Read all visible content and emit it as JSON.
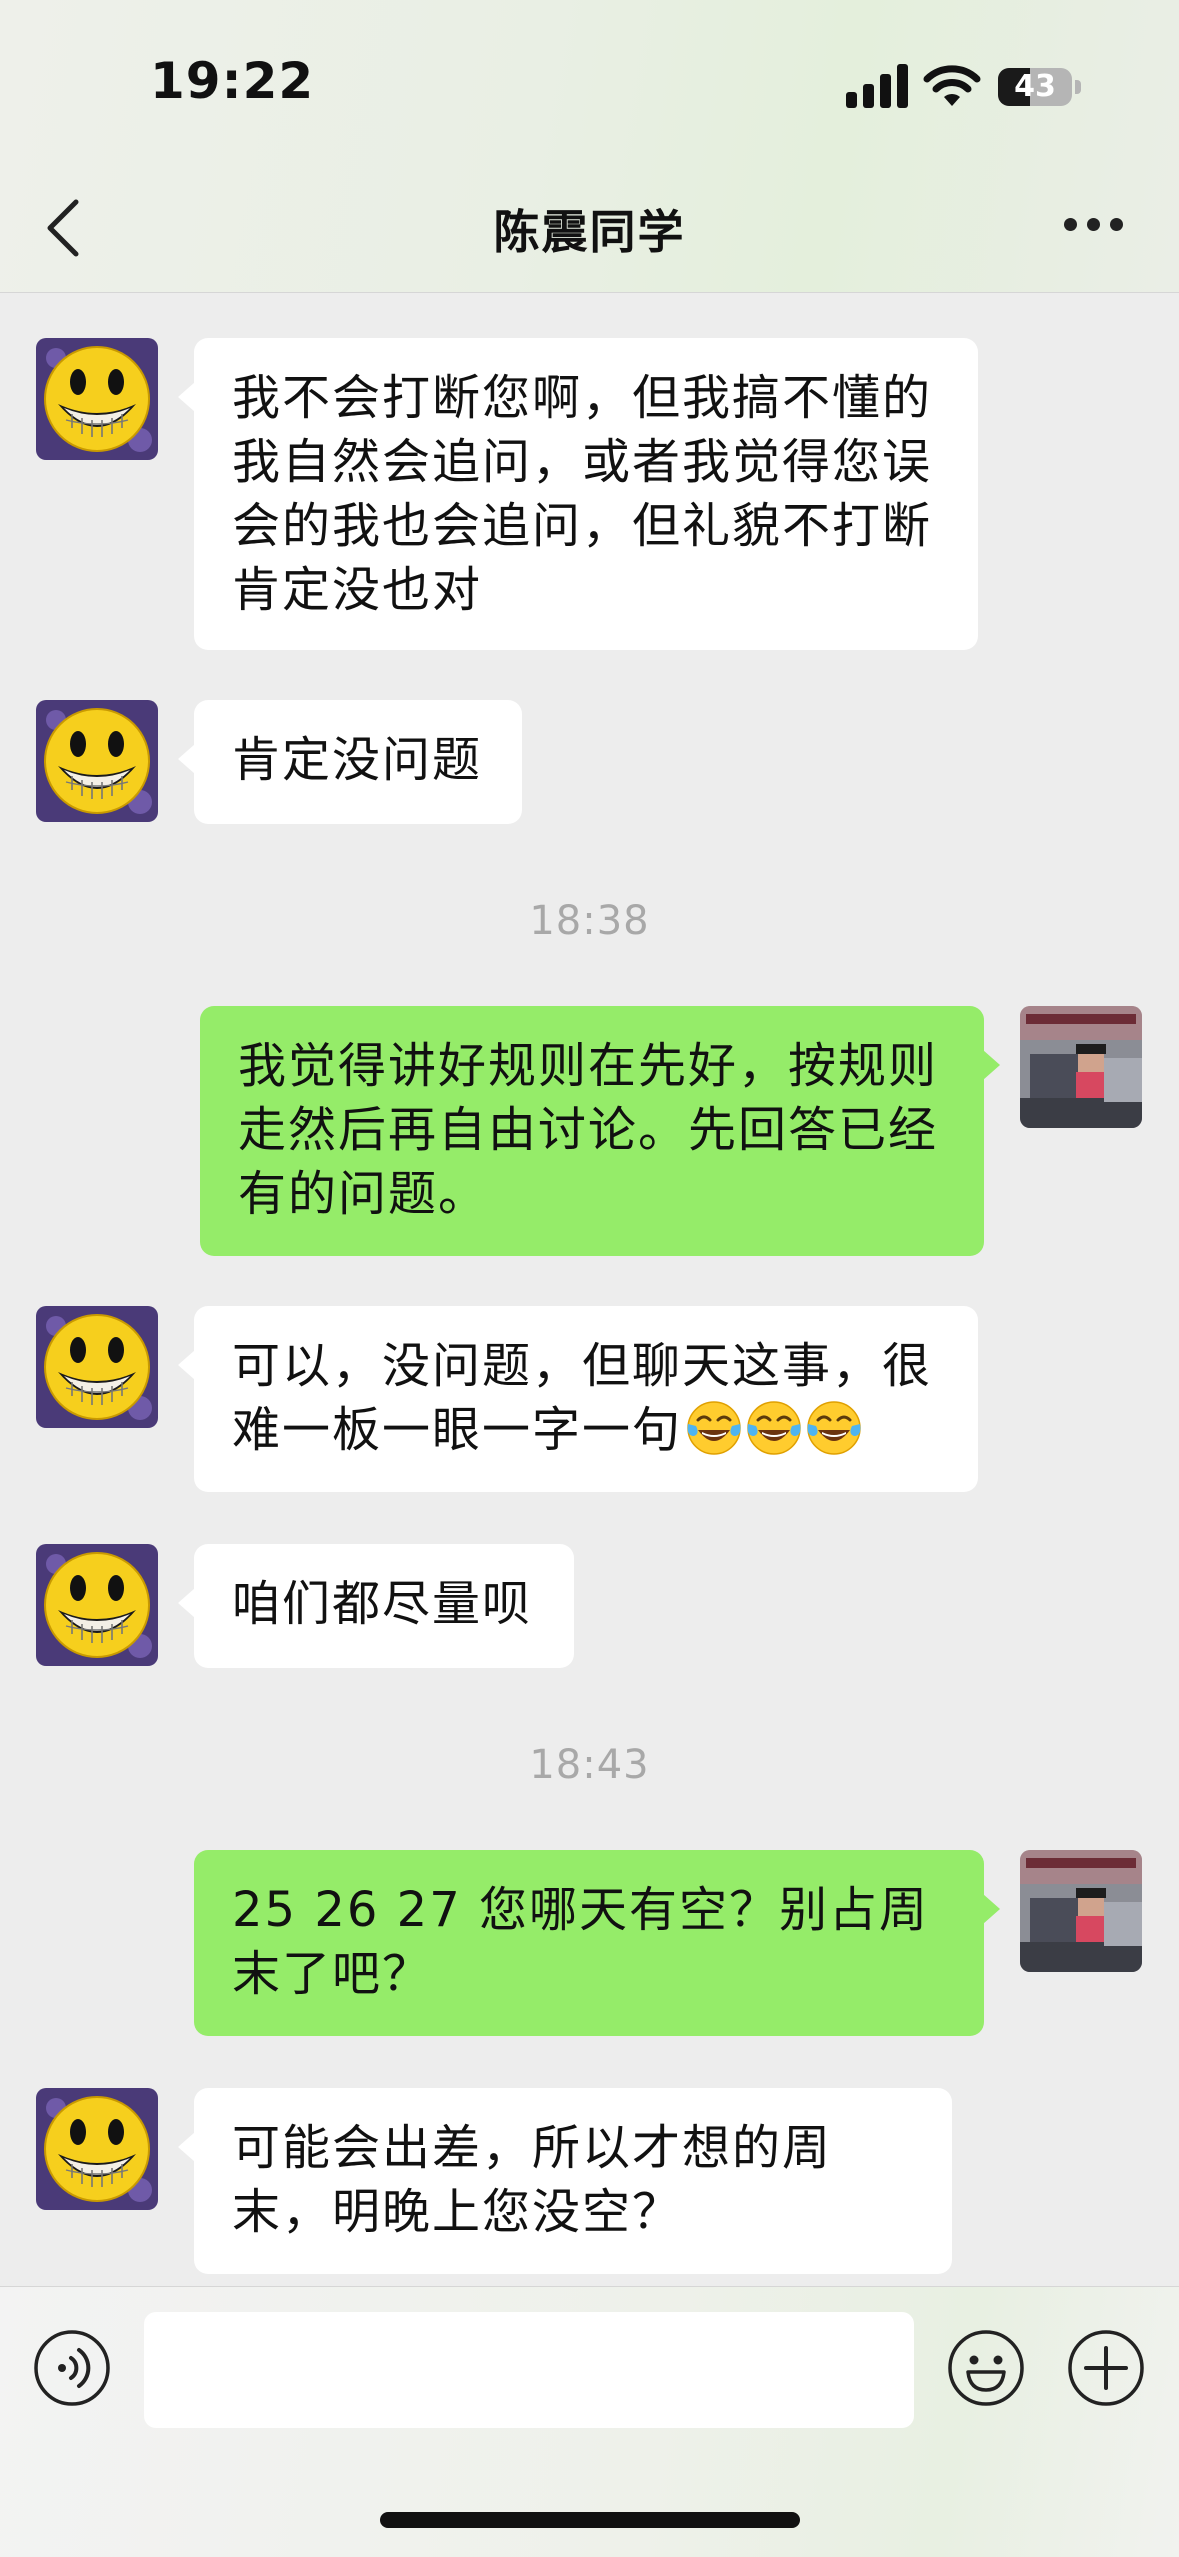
{
  "status_bar": {
    "time": "19:22",
    "battery": "43",
    "battery_level": 0.43
  },
  "header": {
    "title": "陈震同学"
  },
  "messages": [
    {
      "side": "in",
      "text": "我不会打断您啊，但我搞不懂的我自然会追问，或者我觉得您误会的我也会追问，但礼貌不打断肯定没也对"
    },
    {
      "side": "in",
      "text": "肯定没问题"
    },
    {
      "type": "time",
      "text": "18:38"
    },
    {
      "side": "out",
      "text": "我觉得讲好规则在先好，按规则走然后再自由讨论。先回答已经有的问题。"
    },
    {
      "side": "in",
      "text": "可以，没问题，但聊天这事，很难一板一眼一字一句",
      "emoji": [
        "face-with-tears-of-joy-icon",
        "face-with-tears-of-joy-icon",
        "face-with-tears-of-joy-icon"
      ]
    },
    {
      "side": "in",
      "text": "咱们都尽量呗"
    },
    {
      "type": "time",
      "text": "18:43"
    },
    {
      "side": "out",
      "text": "25 26 27 您哪天有空？别占周末了吧？"
    },
    {
      "side": "in",
      "text": "可能会出差，所以才想的周末，明晚上您没空？"
    }
  ],
  "input_bar": {
    "value": "",
    "placeholder": ""
  },
  "icons": {
    "back": "chevron-left-icon",
    "more": "more-dots-icon",
    "voice": "voice-icon",
    "emoji": "smiley-icon",
    "plus": "plus-icon"
  },
  "colors": {
    "outgoing_bubble": "#95ec69",
    "incoming_bubble": "#ffffff",
    "background": "#ededed"
  }
}
